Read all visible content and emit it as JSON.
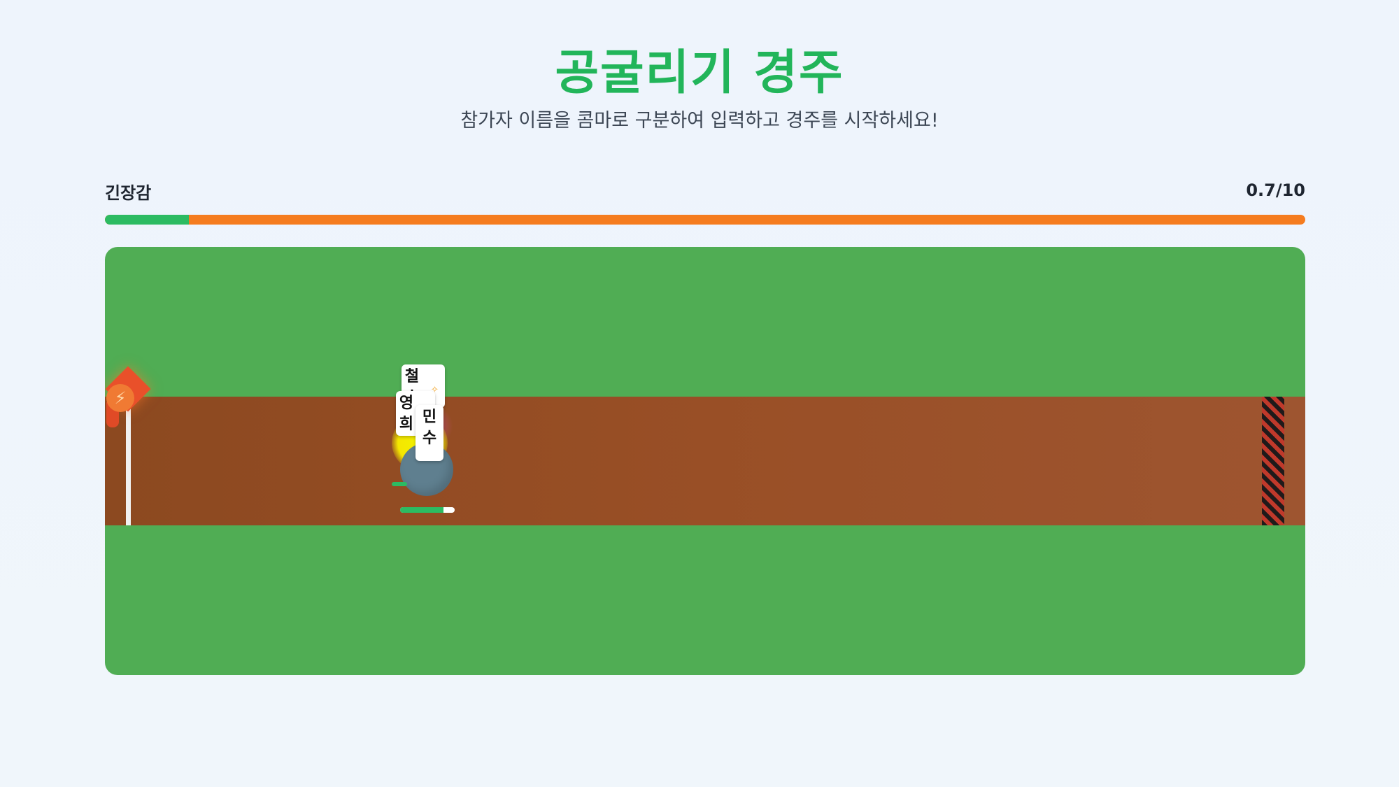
{
  "header": {
    "title": "공굴리기 경주",
    "subtitle": "참가자 이름을 콤마로 구분하여 입력하고 경주를 시작하세요!"
  },
  "tension": {
    "label": "긴장감",
    "display": "0.7/10",
    "value": 0.7,
    "max": 10
  },
  "race": {
    "start_icon": "lightning-icon",
    "players": [
      {
        "name": "철수",
        "effect_icon": "sparkle-icon"
      },
      {
        "name": "영희",
        "effect_icon": "sparkle-icon"
      },
      {
        "name": "민수"
      }
    ],
    "ball": {
      "power": 0.8
    }
  },
  "colors": {
    "title": "#22b55a",
    "tension_fill": "#2cbb62",
    "tension_track": "#f57c1f",
    "grass": "#50ad54",
    "dirt": "#994f26",
    "ball": "#5f7f8f",
    "glow": "#f2f100",
    "start_flag": "#e9502a"
  }
}
